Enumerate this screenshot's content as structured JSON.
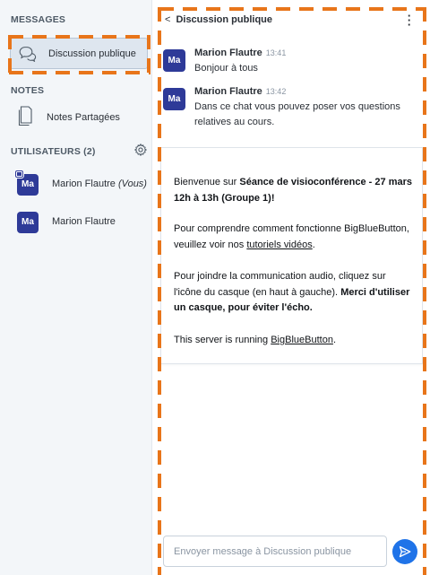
{
  "sidebar": {
    "messages_title": "MESSAGES",
    "public_chat_label": "Discussion publique",
    "notes_title": "NOTES",
    "shared_notes_label": "Notes Partagées",
    "users_title": "UTILISATEURS (2)",
    "users": [
      {
        "initials": "Ma",
        "name": "Marion Flautre",
        "suffix": "(Vous)"
      },
      {
        "initials": "Ma",
        "name": "Marion Flautre",
        "suffix": ""
      }
    ]
  },
  "chat": {
    "title": "Discussion publique",
    "back_glyph": "<",
    "messages": [
      {
        "initials": "Ma",
        "sender": "Marion Flautre",
        "time": "13:41",
        "text": "Bonjour à tous"
      },
      {
        "initials": "Ma",
        "sender": "Marion Flautre",
        "time": "13:42",
        "text": "Dans ce chat vous pouvez poser vos questions relatives au cours."
      }
    ],
    "welcome": {
      "p1_prefix": "Bienvenue sur ",
      "p1_bold": "Séance de visioconférence - 27 mars 12h à 13h (Groupe 1)",
      "p1_suffix": "!",
      "p2_prefix": "Pour comprendre comment fonctionne BigBlueButton, veuillez voir nos ",
      "p2_link": "tutoriels vidéos",
      "p2_suffix": ".",
      "p3_prefix": "Pour joindre la communication audio, cliquez sur l'icône du casque (en haut à gauche). ",
      "p3_bold": "Merci d'utiliser un casque, pour éviter l'écho.",
      "p4_prefix": "This server is running ",
      "p4_link": "BigBlueButton",
      "p4_suffix": "."
    },
    "input_placeholder": "Envoyer message à Discussion publique"
  },
  "colors": {
    "avatar": "#2e3a98",
    "send_button": "#1f73e8",
    "annotation_dash": "#e8751a",
    "sidebar_bg": "#f3f6f9"
  },
  "icons": [
    "chat-bubbles-icon",
    "document-icon",
    "gear-icon",
    "presenter-badge-icon",
    "chevron-left-icon",
    "kebab-menu-icon",
    "send-icon"
  ]
}
